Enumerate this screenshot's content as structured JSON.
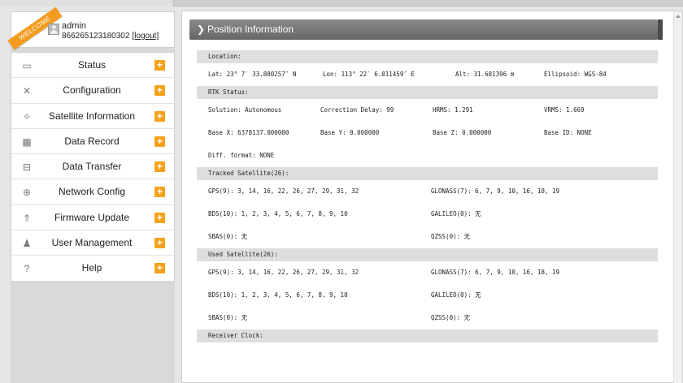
{
  "user": {
    "ribbon": "WELCOME",
    "name": "admin",
    "id": "866265123180302",
    "logout": "[logout]"
  },
  "menu": [
    {
      "label": "Status",
      "icon": "monitor-icon"
    },
    {
      "label": "Configuration",
      "icon": "tools-icon"
    },
    {
      "label": "Satellite Information",
      "icon": "satellite-icon"
    },
    {
      "label": "Data Record",
      "icon": "calendar-icon"
    },
    {
      "label": "Data Transfer",
      "icon": "transfer-icon"
    },
    {
      "label": "Network Config",
      "icon": "globe-icon"
    },
    {
      "label": "Firmware Update",
      "icon": "upload-icon"
    },
    {
      "label": "User Management",
      "icon": "users-icon"
    },
    {
      "label": "Help",
      "icon": "help-icon"
    }
  ],
  "panel": {
    "title": "Position Information"
  },
  "sections": {
    "location": {
      "header": "Location:",
      "lat": "Lat: 23° 7′ 33.880257″ N",
      "lon": "Lon: 113° 22′ 6.011459″ E",
      "alt": "Alt: 31.681396 m",
      "ellipsoid": "Ellipsoid: WGS-84"
    },
    "rtk": {
      "header": "RTK Status:",
      "solution": "Solution: Autonomous",
      "correction_delay": "Correction Delay: 99",
      "hrms": "HRMS: 1.291",
      "vrms": "VRMS: 1.669",
      "base_x": "Base X: 6378137.000000",
      "base_y": "Base Y: 0.000000",
      "base_z": "Base Z: 0.000000",
      "base_id": "Base ID: NONE",
      "diff_format": "Diff. format: NONE"
    },
    "tracked": {
      "header": "Tracked Satellite(26):",
      "gps": "GPS(9): 3, 14, 16, 22, 26, 27, 29, 31, 32",
      "glonass": "GLONASS(7): 6, 7, 9, 10, 16, 18, 19",
      "bds": "BDS(10): 1, 2, 3, 4, 5, 6, 7, 8, 9, 10",
      "galileo": "GALILEO(0): 无",
      "sbas": "SBAS(0): 无",
      "qzss": "QZSS(0): 无"
    },
    "used": {
      "header": "Used Satellite(26):",
      "gps": "GPS(9): 3, 14, 16, 22, 26, 27, 29, 31, 32",
      "glonass": "GLONASS(7): 6, 7, 9, 10, 16, 18, 19",
      "bds": "BDS(10): 1, 2, 3, 4, 5, 6, 7, 8, 9, 10",
      "galileo": "GALILEO(0): 无",
      "sbas": "SBAS(0): 无",
      "qzss": "QZSS(0): 无"
    },
    "clock": {
      "header": "Receiver Clock:"
    }
  }
}
